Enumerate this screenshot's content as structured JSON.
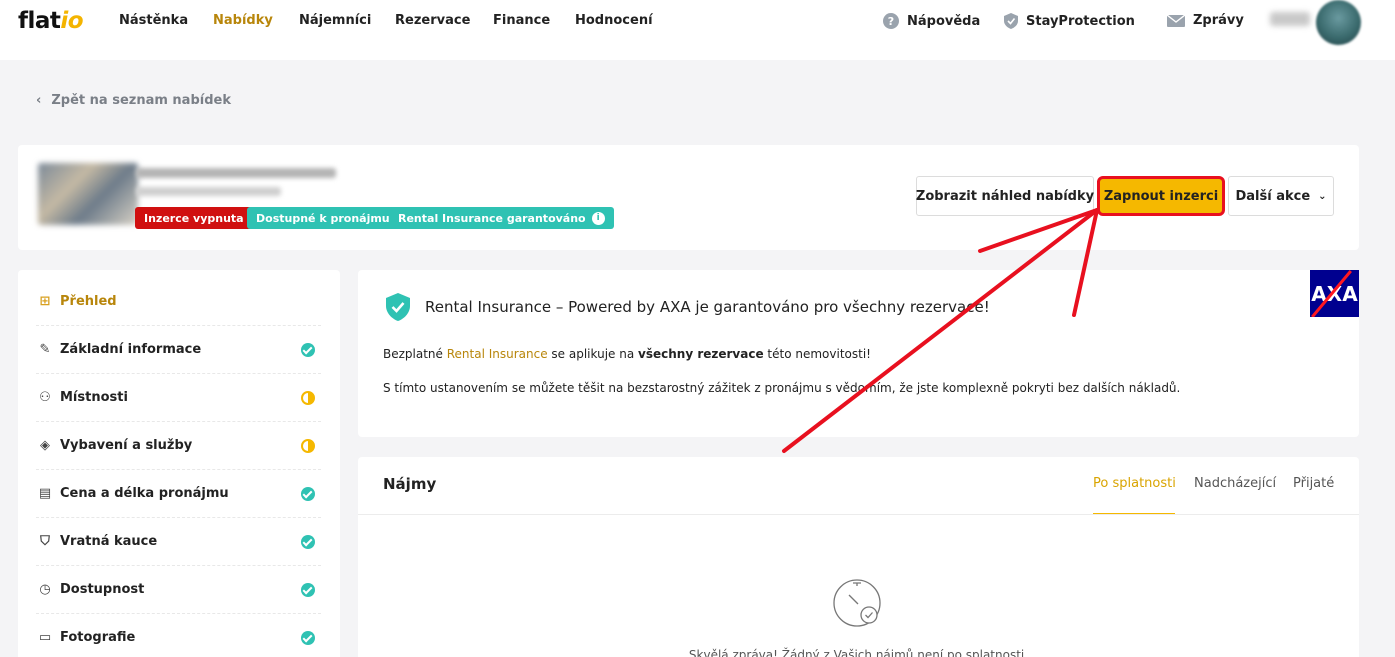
{
  "nav": {
    "logo_text": "flat",
    "logo_accent": "io",
    "items": [
      "Nástěnka",
      "Nabídky",
      "Nájemníci",
      "Rezervace",
      "Finance",
      "Hodnocení"
    ],
    "help": "Nápověda",
    "protection": "StayProtection",
    "messages": "Zprávy"
  },
  "back_link": "Zpět na seznam nabídek",
  "listing": {
    "badges": [
      "Inzerce vypnuta",
      "Dostupné k pronájmu",
      "Rental Insurance garantováno"
    ],
    "buttons": {
      "preview": "Zobrazit náhled nabídky",
      "enable": "Zapnout inzerci",
      "more": "Další akce"
    }
  },
  "sidebar": {
    "items": [
      {
        "label": "Přehled",
        "icon": "grid-icon",
        "status": "none"
      },
      {
        "label": "Základní informace",
        "icon": "pencil-icon",
        "status": "done"
      },
      {
        "label": "Místnosti",
        "icon": "rooms-icon",
        "status": "partial"
      },
      {
        "label": "Vybavení a služby",
        "icon": "layers-icon",
        "status": "partial"
      },
      {
        "label": "Cena a délka pronájmu",
        "icon": "coins-icon",
        "status": "done"
      },
      {
        "label": "Vratná kauce",
        "icon": "shield-icon",
        "status": "done"
      },
      {
        "label": "Dostupnost",
        "icon": "clock-icon",
        "status": "done"
      },
      {
        "label": "Fotografie",
        "icon": "photo-icon",
        "status": "done"
      }
    ]
  },
  "insurance": {
    "title": "Rental Insurance – Powered by AXA je garantováno pro všechny rezervace!",
    "p1_before": "Bezplatné ",
    "p1_link": "Rental Insurance",
    "p1_middle": " se aplikuje na ",
    "p1_bold": "všechny rezervace",
    "p1_after": " této nemovitosti!",
    "p2": "S tímto ustanovením se můžete těšit na bezstarostný zážitek z pronájmu s vědomím, že jste komplexně pokryti bez dalších nákladů.",
    "logo": "AXA"
  },
  "rents": {
    "title": "Nájmy",
    "tabs": [
      "Po splatnosti",
      "Nadcházející",
      "Přijaté"
    ],
    "empty": "Skvělá zpráva! Žádný z Vašich nájmů není po splatnosti."
  },
  "colors": {
    "accent": "#f5b800",
    "active_text": "#b8860b",
    "badge_red": "#d01010",
    "badge_teal": "#2fc2b3",
    "annotation": "#e8101f"
  }
}
